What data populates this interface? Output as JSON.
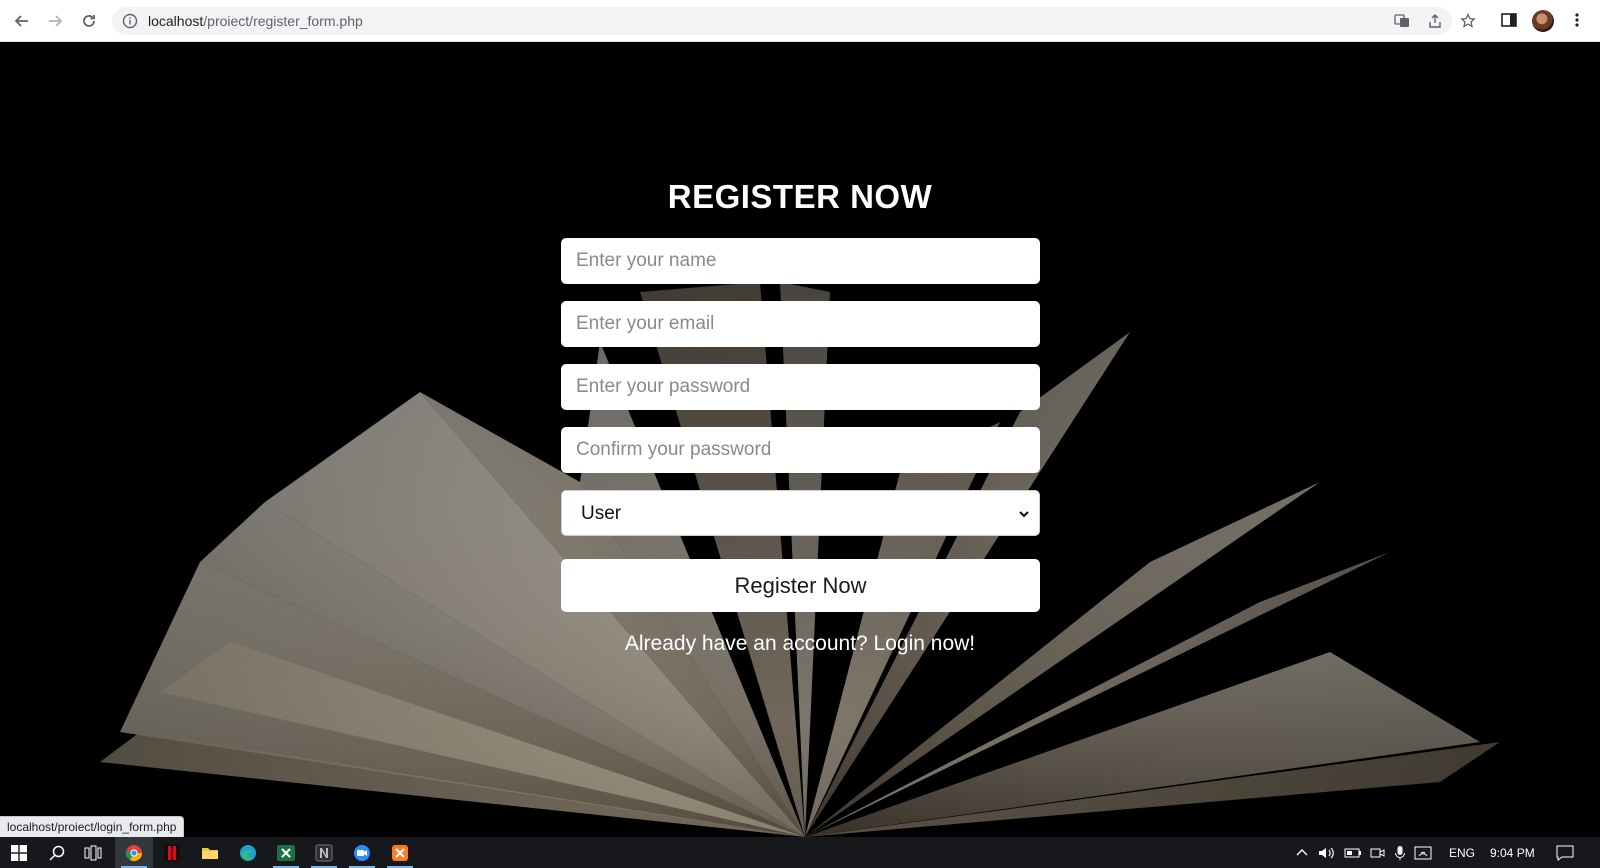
{
  "browser": {
    "url_host": "localhost",
    "url_path": "/proiect/register_form.php",
    "status_bar_url": "localhost/proiect/login_form.php"
  },
  "form": {
    "title": "REGISTER NOW",
    "name_placeholder": "Enter your name",
    "email_placeholder": "Enter your email",
    "password_placeholder": "Enter your password",
    "confirm_placeholder": "Confirm your password",
    "user_type_selected": "User",
    "submit_label": "Register Now",
    "login_prompt": "Already have an account? Login now!"
  },
  "taskbar": {
    "language": "ENG",
    "time": "9:04 PM",
    "apps": [
      "windows-start",
      "search",
      "task-view",
      "chrome",
      "netflix",
      "file-explorer",
      "edge",
      "excel",
      "notion",
      "zoom",
      "xampp"
    ]
  },
  "colors": {
    "page_background": "#000000",
    "input_background": "#ffffff",
    "text_white": "#ffffff"
  }
}
